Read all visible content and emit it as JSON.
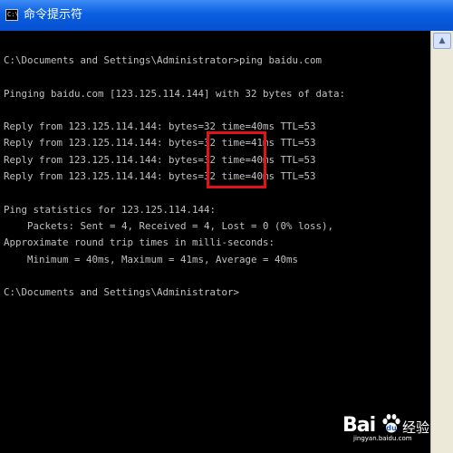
{
  "window": {
    "title": "命令提示符",
    "icon": "cmd-icon",
    "icon_text": "C:\\"
  },
  "console": {
    "lines": [
      "C:\\Documents and Settings\\Administrator>ping baidu.com",
      "",
      "Pinging baidu.com [123.125.114.144] with 32 bytes of data:",
      "",
      "Reply from 123.125.114.144: bytes=32 time=40ms TTL=53",
      "Reply from 123.125.114.144: bytes=32 time=41ms TTL=53",
      "Reply from 123.125.114.144: bytes=32 time=40ms TTL=53",
      "Reply from 123.125.114.144: bytes=32 time=40ms TTL=53",
      "",
      "Ping statistics for 123.125.114.144:",
      "    Packets: Sent = 4, Received = 4, Lost = 0 (0% loss),",
      "Approximate round trip times in milli-seconds:",
      "    Minimum = 40ms, Maximum = 41ms, Average = 40ms",
      "",
      "C:\\Documents and Settings\\Administrator>"
    ]
  },
  "annotation": {
    "color": "#e0121a"
  },
  "watermark": {
    "brand_prefix": "Bai",
    "paw_icon": "baidu-paw-icon",
    "brand_suffix": "经验",
    "url": "jingyan.baidu.com"
  },
  "colors": {
    "titlebar": "#0a5fe0",
    "console_bg": "#000000",
    "console_text": "#c0c0c0"
  }
}
